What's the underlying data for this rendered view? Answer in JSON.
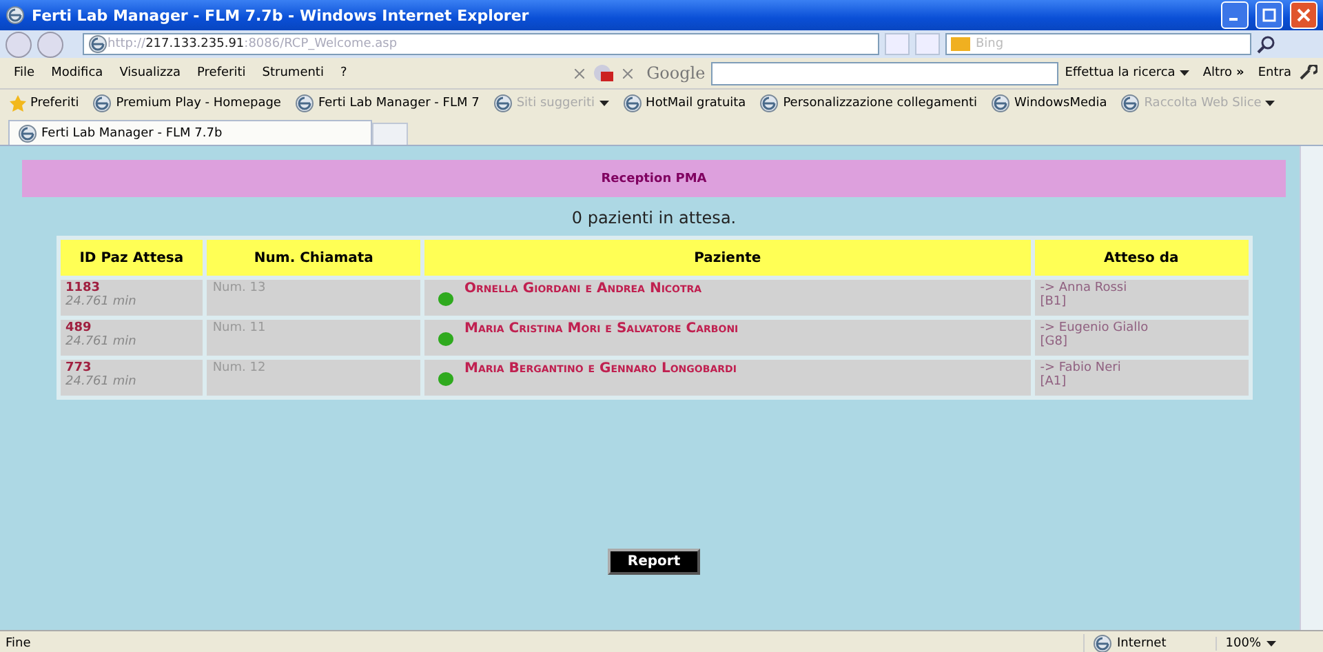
{
  "window": {
    "title": "Ferti Lab Manager - FLM 7.7b - Windows Internet Explorer"
  },
  "address_bar": {
    "url_scheme": "http://",
    "url_host": "217.133.235.91",
    "url_path": ":8086/RCP_Welcome.asp",
    "search_placeholder": "Bing"
  },
  "menu": [
    "File",
    "Modifica",
    "Visualizza",
    "Preferiti",
    "Strumenti",
    "?"
  ],
  "google_toolbar": {
    "logo": "Google",
    "search_button": "Effettua la ricerca",
    "more": "Altro",
    "more_glyph": "»",
    "sign_in": "Entra"
  },
  "favorites_bar": {
    "label": "Preferiti",
    "items": [
      {
        "label": "Premium Play - Homepage",
        "disabled": false,
        "dropdown": false
      },
      {
        "label": "Ferti Lab Manager - FLM 7",
        "disabled": false,
        "dropdown": false
      },
      {
        "label": "Siti suggeriti",
        "disabled": true,
        "dropdown": true
      },
      {
        "label": "HotMail gratuita",
        "disabled": false,
        "dropdown": false
      },
      {
        "label": "Personalizzazione collegamenti",
        "disabled": false,
        "dropdown": false
      },
      {
        "label": "WindowsMedia",
        "disabled": false,
        "dropdown": false
      },
      {
        "label": "Raccolta Web Slice",
        "disabled": true,
        "dropdown": true
      }
    ]
  },
  "tabs": [
    {
      "label": "Ferti Lab Manager - FLM 7.7b",
      "selected": true
    }
  ],
  "page": {
    "header": "Reception PMA",
    "waiting_text": "0 pazienti in attesa.",
    "table": {
      "columns": [
        "ID Paz Attesa",
        "Num. Chiamata",
        "Paziente",
        "Atteso da"
      ],
      "rows": [
        {
          "id": "1183",
          "wait": "24.761 min",
          "call": "Num. 13",
          "patient": "Ornella Giordani e Andrea Nicotra",
          "color": "#2faa1e",
          "doctor": "-> Anna Rossi",
          "room": "[B1]"
        },
        {
          "id": "489",
          "wait": "24.761 min",
          "call": "Num. 11",
          "patient": "Maria Cristina Mori e Salvatore Carboni",
          "color": "#2faa1e",
          "doctor": "-> Eugenio Giallo",
          "room": "[G8]"
        },
        {
          "id": "773",
          "wait": "24.761 min",
          "call": "Num. 12",
          "patient": "Maria Bergantino e Gennaro Longobardi",
          "color": "#2faa1e",
          "doctor": "-> Fabio Neri",
          "room": "[A1]"
        }
      ]
    },
    "report_button": "Report"
  },
  "status_bar": {
    "status": "Fine",
    "zone": "Internet",
    "zoom": "100%"
  }
}
